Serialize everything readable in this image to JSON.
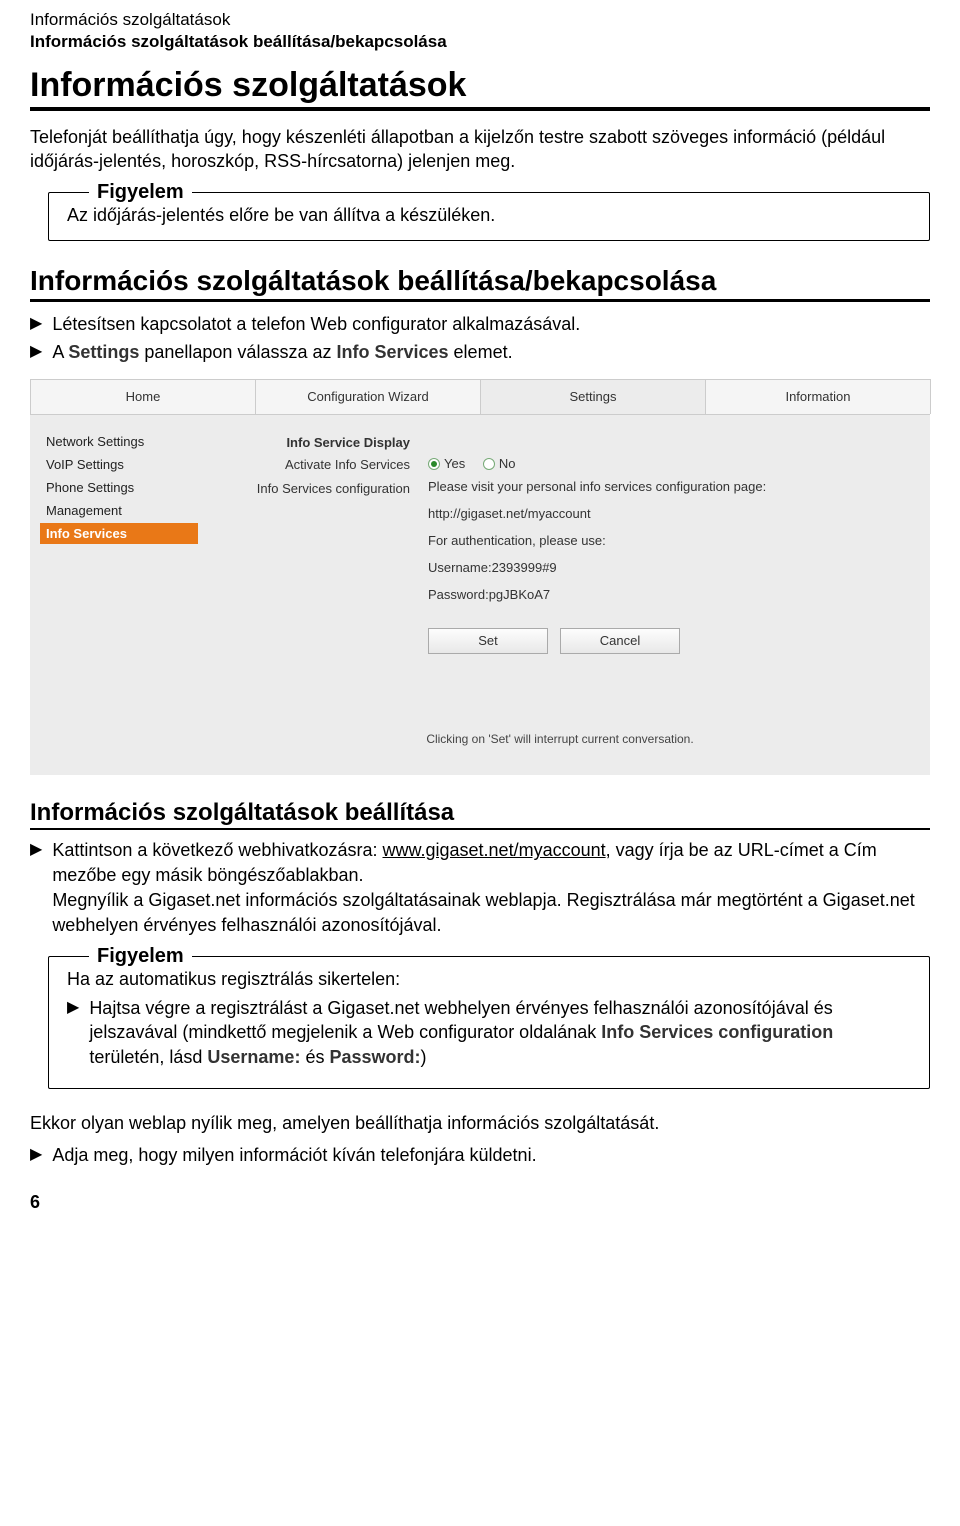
{
  "header": {
    "line1": "Információs szolgáltatások",
    "line2": "Információs szolgáltatások beállítása/bekapcsolása"
  },
  "h1": "Információs szolgáltatások",
  "intro": "Telefonját beállíthatja úgy, hogy készenléti állapotban a kijelzőn testre szabott szöveges információ (például időjárás-jelentés, horoszkóp, RSS-hírcsatorna) jelenjen meg.",
  "note1": {
    "title": "Figyelem",
    "body": "Az időjárás-jelentés előre be van állítva a készüléken."
  },
  "h2": "Információs szolgáltatások beállítása/bekapcsolása",
  "steps1": {
    "a": "Létesítsen kapcsolatot a telefon Web configurator alkalmazásával.",
    "b_pre": "A ",
    "b_s1": "Settings",
    "b_mid": " panellapon válassza az ",
    "b_s2": "Info Services",
    "b_post": " elemet."
  },
  "webcfg": {
    "tabs": [
      "Home",
      "Configuration Wizard",
      "Settings",
      "Information"
    ],
    "active_tab": 2,
    "side": [
      "Network Settings",
      "VoIP Settings",
      "Phone Settings",
      "Management",
      "Info Services"
    ],
    "side_active": 4,
    "section_title": "Info Service Display",
    "row_activate": "Activate Info Services",
    "radio_yes": "Yes",
    "radio_no": "No",
    "row_cfg": "Info Services configuration",
    "cfg_msg": "Please visit your personal info services configuration page:",
    "cfg_url": "http://gigaset.net/myaccount",
    "cfg_auth": "For authentication, please use:",
    "cfg_user": "Username:2393999#9",
    "cfg_pass": "Password:pgJBKoA7",
    "btn_set": "Set",
    "btn_cancel": "Cancel",
    "footnote": "Clicking on 'Set' will interrupt current conversation."
  },
  "h3": "Információs szolgáltatások beállítása",
  "steps2": {
    "a_pre": "Kattintson a következő webhivatkozásra: ",
    "a_link": "www.gigaset.net/myaccount",
    "a_post": ", vagy írja be az URL-címet a Cím mezőbe egy másik böngészőablakban.",
    "b": "Megnyílik a Gigaset.net információs szolgáltatásainak weblapja. Regisztrálása már megtörtént a Gigaset.net webhelyen érvényes felhasználói azonosítójával."
  },
  "note2": {
    "title": "Figyelem",
    "intro": "Ha az automatikus regisztrálás sikertelen:",
    "bullet_pre": "Hajtsa végre a regisztrálást a Gigaset.net webhelyen érvényes felhasználói azonosítójával és jelszavával (mindkettő megjelenik a Web configurator oldalának ",
    "bullet_s1": "Info Services configuration",
    "bullet_mid": " területén, lásd ",
    "bullet_s2": "Username:",
    "bullet_and": " és ",
    "bullet_s3": "Password:",
    "bullet_post": ")"
  },
  "outro": "Ekkor olyan weblap nyílik meg, amelyen beállíthatja információs szolgáltatását.",
  "outro_bullet": "Adja meg, hogy milyen információt kíván telefonjára küldetni.",
  "pagenum": "6"
}
